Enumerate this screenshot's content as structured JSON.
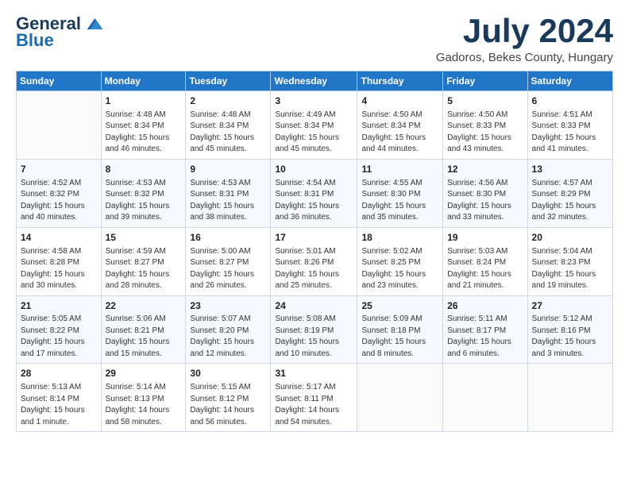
{
  "header": {
    "logo": {
      "line1": "General",
      "line2": "Blue"
    },
    "title": "July 2024",
    "location": "Gadoros, Bekes County, Hungary"
  },
  "weekdays": [
    "Sunday",
    "Monday",
    "Tuesday",
    "Wednesday",
    "Thursday",
    "Friday",
    "Saturday"
  ],
  "weeks": [
    [
      {
        "day": "",
        "sunrise": "",
        "sunset": "",
        "daylight": ""
      },
      {
        "day": "1",
        "sunrise": "Sunrise: 4:48 AM",
        "sunset": "Sunset: 8:34 PM",
        "daylight": "Daylight: 15 hours and 46 minutes."
      },
      {
        "day": "2",
        "sunrise": "Sunrise: 4:48 AM",
        "sunset": "Sunset: 8:34 PM",
        "daylight": "Daylight: 15 hours and 45 minutes."
      },
      {
        "day": "3",
        "sunrise": "Sunrise: 4:49 AM",
        "sunset": "Sunset: 8:34 PM",
        "daylight": "Daylight: 15 hours and 45 minutes."
      },
      {
        "day": "4",
        "sunrise": "Sunrise: 4:50 AM",
        "sunset": "Sunset: 8:34 PM",
        "daylight": "Daylight: 15 hours and 44 minutes."
      },
      {
        "day": "5",
        "sunrise": "Sunrise: 4:50 AM",
        "sunset": "Sunset: 8:33 PM",
        "daylight": "Daylight: 15 hours and 43 minutes."
      },
      {
        "day": "6",
        "sunrise": "Sunrise: 4:51 AM",
        "sunset": "Sunset: 8:33 PM",
        "daylight": "Daylight: 15 hours and 41 minutes."
      }
    ],
    [
      {
        "day": "7",
        "sunrise": "Sunrise: 4:52 AM",
        "sunset": "Sunset: 8:32 PM",
        "daylight": "Daylight: 15 hours and 40 minutes."
      },
      {
        "day": "8",
        "sunrise": "Sunrise: 4:53 AM",
        "sunset": "Sunset: 8:32 PM",
        "daylight": "Daylight: 15 hours and 39 minutes."
      },
      {
        "day": "9",
        "sunrise": "Sunrise: 4:53 AM",
        "sunset": "Sunset: 8:31 PM",
        "daylight": "Daylight: 15 hours and 38 minutes."
      },
      {
        "day": "10",
        "sunrise": "Sunrise: 4:54 AM",
        "sunset": "Sunset: 8:31 PM",
        "daylight": "Daylight: 15 hours and 36 minutes."
      },
      {
        "day": "11",
        "sunrise": "Sunrise: 4:55 AM",
        "sunset": "Sunset: 8:30 PM",
        "daylight": "Daylight: 15 hours and 35 minutes."
      },
      {
        "day": "12",
        "sunrise": "Sunrise: 4:56 AM",
        "sunset": "Sunset: 8:30 PM",
        "daylight": "Daylight: 15 hours and 33 minutes."
      },
      {
        "day": "13",
        "sunrise": "Sunrise: 4:57 AM",
        "sunset": "Sunset: 8:29 PM",
        "daylight": "Daylight: 15 hours and 32 minutes."
      }
    ],
    [
      {
        "day": "14",
        "sunrise": "Sunrise: 4:58 AM",
        "sunset": "Sunset: 8:28 PM",
        "daylight": "Daylight: 15 hours and 30 minutes."
      },
      {
        "day": "15",
        "sunrise": "Sunrise: 4:59 AM",
        "sunset": "Sunset: 8:27 PM",
        "daylight": "Daylight: 15 hours and 28 minutes."
      },
      {
        "day": "16",
        "sunrise": "Sunrise: 5:00 AM",
        "sunset": "Sunset: 8:27 PM",
        "daylight": "Daylight: 15 hours and 26 minutes."
      },
      {
        "day": "17",
        "sunrise": "Sunrise: 5:01 AM",
        "sunset": "Sunset: 8:26 PM",
        "daylight": "Daylight: 15 hours and 25 minutes."
      },
      {
        "day": "18",
        "sunrise": "Sunrise: 5:02 AM",
        "sunset": "Sunset: 8:25 PM",
        "daylight": "Daylight: 15 hours and 23 minutes."
      },
      {
        "day": "19",
        "sunrise": "Sunrise: 5:03 AM",
        "sunset": "Sunset: 8:24 PM",
        "daylight": "Daylight: 15 hours and 21 minutes."
      },
      {
        "day": "20",
        "sunrise": "Sunrise: 5:04 AM",
        "sunset": "Sunset: 8:23 PM",
        "daylight": "Daylight: 15 hours and 19 minutes."
      }
    ],
    [
      {
        "day": "21",
        "sunrise": "Sunrise: 5:05 AM",
        "sunset": "Sunset: 8:22 PM",
        "daylight": "Daylight: 15 hours and 17 minutes."
      },
      {
        "day": "22",
        "sunrise": "Sunrise: 5:06 AM",
        "sunset": "Sunset: 8:21 PM",
        "daylight": "Daylight: 15 hours and 15 minutes."
      },
      {
        "day": "23",
        "sunrise": "Sunrise: 5:07 AM",
        "sunset": "Sunset: 8:20 PM",
        "daylight": "Daylight: 15 hours and 12 minutes."
      },
      {
        "day": "24",
        "sunrise": "Sunrise: 5:08 AM",
        "sunset": "Sunset: 8:19 PM",
        "daylight": "Daylight: 15 hours and 10 minutes."
      },
      {
        "day": "25",
        "sunrise": "Sunrise: 5:09 AM",
        "sunset": "Sunset: 8:18 PM",
        "daylight": "Daylight: 15 hours and 8 minutes."
      },
      {
        "day": "26",
        "sunrise": "Sunrise: 5:11 AM",
        "sunset": "Sunset: 8:17 PM",
        "daylight": "Daylight: 15 hours and 6 minutes."
      },
      {
        "day": "27",
        "sunrise": "Sunrise: 5:12 AM",
        "sunset": "Sunset: 8:16 PM",
        "daylight": "Daylight: 15 hours and 3 minutes."
      }
    ],
    [
      {
        "day": "28",
        "sunrise": "Sunrise: 5:13 AM",
        "sunset": "Sunset: 8:14 PM",
        "daylight": "Daylight: 15 hours and 1 minute."
      },
      {
        "day": "29",
        "sunrise": "Sunrise: 5:14 AM",
        "sunset": "Sunset: 8:13 PM",
        "daylight": "Daylight: 14 hours and 58 minutes."
      },
      {
        "day": "30",
        "sunrise": "Sunrise: 5:15 AM",
        "sunset": "Sunset: 8:12 PM",
        "daylight": "Daylight: 14 hours and 56 minutes."
      },
      {
        "day": "31",
        "sunrise": "Sunrise: 5:17 AM",
        "sunset": "Sunset: 8:11 PM",
        "daylight": "Daylight: 14 hours and 54 minutes."
      },
      {
        "day": "",
        "sunrise": "",
        "sunset": "",
        "daylight": ""
      },
      {
        "day": "",
        "sunrise": "",
        "sunset": "",
        "daylight": ""
      },
      {
        "day": "",
        "sunrise": "",
        "sunset": "",
        "daylight": ""
      }
    ]
  ]
}
